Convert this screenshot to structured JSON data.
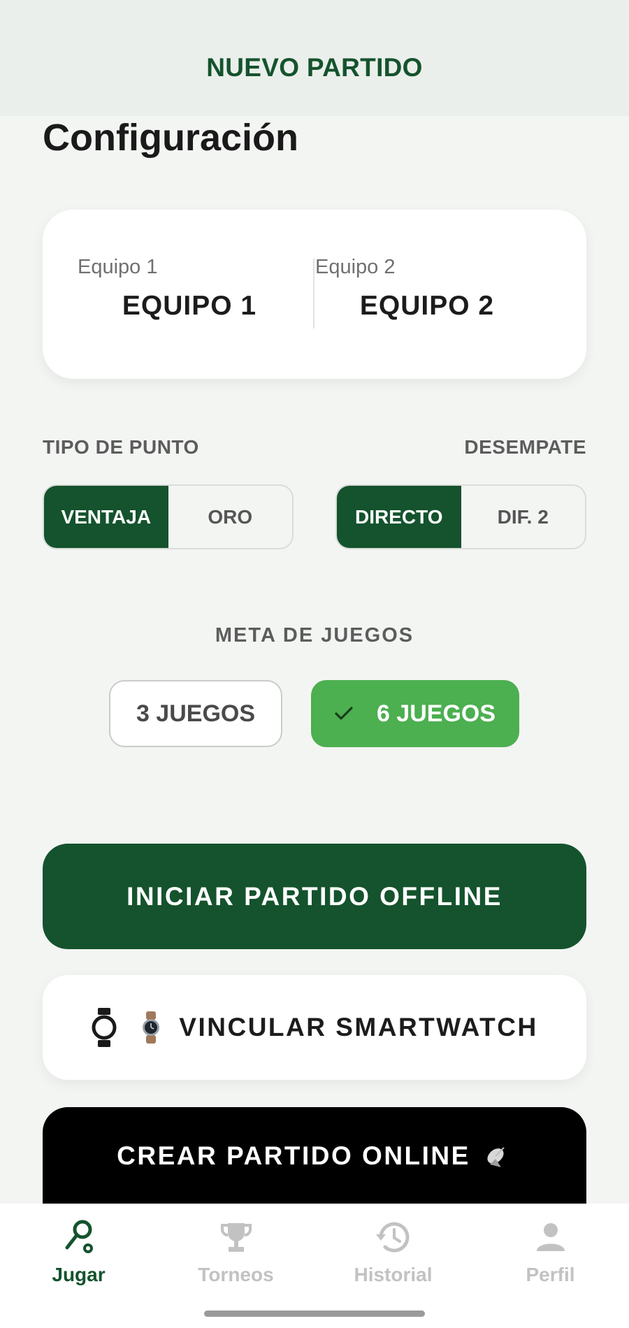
{
  "header": {
    "title": "NUEVO PARTIDO"
  },
  "config": {
    "title": "Configuración"
  },
  "teams": [
    {
      "label": "Equipo 1",
      "name": "EQUIPO 1"
    },
    {
      "label": "Equipo 2",
      "name": "EQUIPO 2"
    }
  ],
  "tipo_punto": {
    "label": "TIPO DE PUNTO",
    "options": [
      "VENTAJA",
      "ORO"
    ],
    "selected": "VENTAJA"
  },
  "desempate": {
    "label": "DESEMPATE",
    "options": [
      "DIRECTO",
      "DIF. 2"
    ],
    "selected": "DIRECTO"
  },
  "meta_juegos": {
    "label": "META DE JUEGOS",
    "options": [
      "3 JUEGOS",
      "6 JUEGOS"
    ],
    "selected": "6 JUEGOS"
  },
  "actions": {
    "offline": "INICIAR PARTIDO OFFLINE",
    "smartwatch": "VINCULAR SMARTWATCH",
    "online": "CREAR PARTIDO ONLINE"
  },
  "nav": [
    {
      "label": "Jugar",
      "icon": "racket-icon",
      "active": true
    },
    {
      "label": "Torneos",
      "icon": "trophy-icon",
      "active": false
    },
    {
      "label": "Historial",
      "icon": "history-icon",
      "active": false
    },
    {
      "label": "Perfil",
      "icon": "person-icon",
      "active": false
    }
  ],
  "colors": {
    "primary": "#14532d",
    "accent_green": "#4caf50",
    "background": "#f3f5f3",
    "inactive": "#c2c2c2"
  }
}
